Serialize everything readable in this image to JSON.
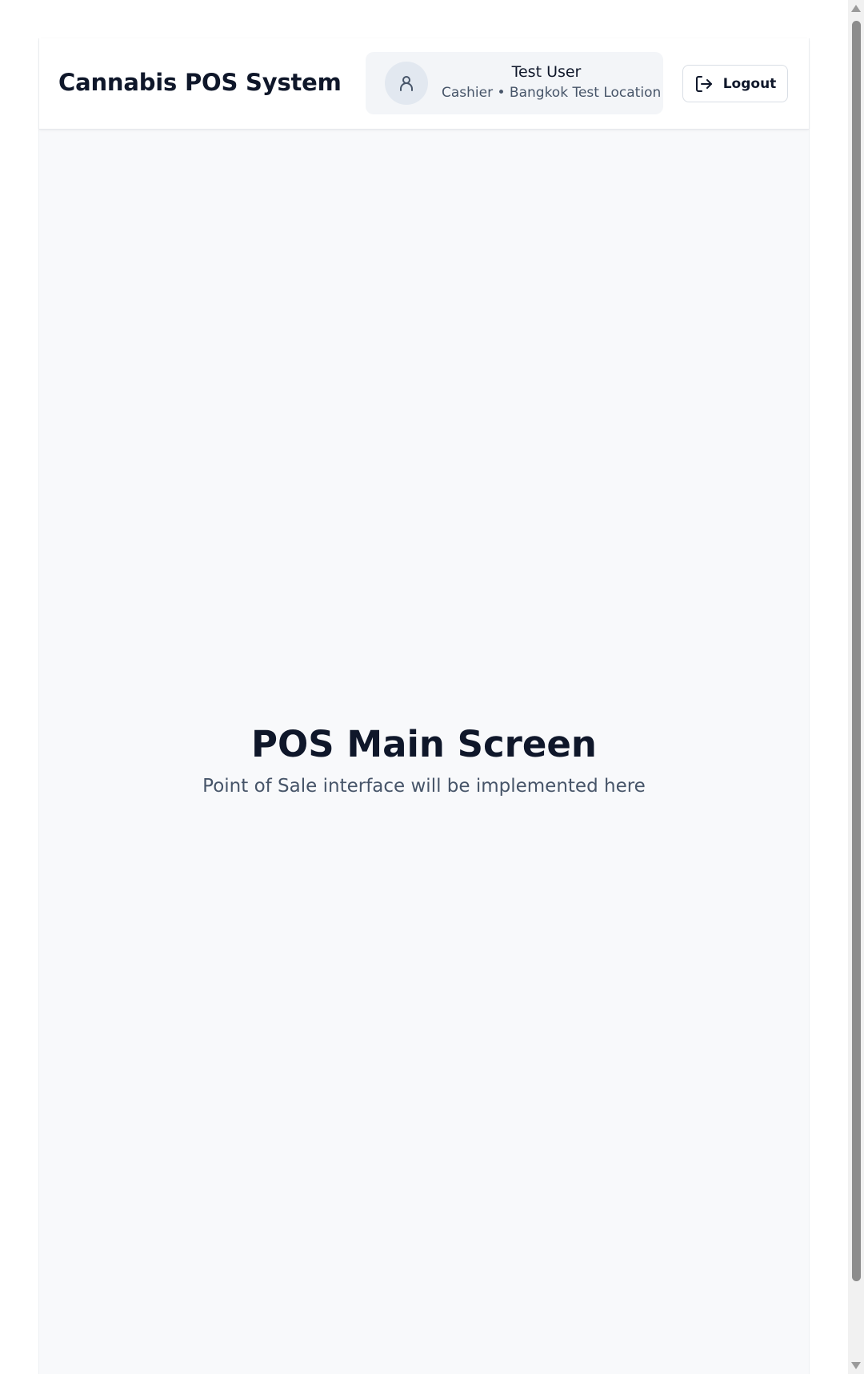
{
  "header": {
    "app_title": "Cannabis POS System",
    "user": {
      "name": "Test User",
      "meta": "Cashier • Bangkok Test Location",
      "avatar_icon": "user-icon"
    },
    "logout": {
      "label": "Logout",
      "icon": "logout-icon"
    }
  },
  "main": {
    "title": "POS Main Screen",
    "subtitle": "Point of Sale interface will be implemented here"
  },
  "colors": {
    "page_background": "#f8f9fb",
    "header_background": "#ffffff",
    "user_card_background": "#f3f5f8",
    "avatar_background": "#e2e8f0",
    "text_primary": "#0f172a",
    "text_secondary": "#475569",
    "border": "#d9dee5"
  }
}
